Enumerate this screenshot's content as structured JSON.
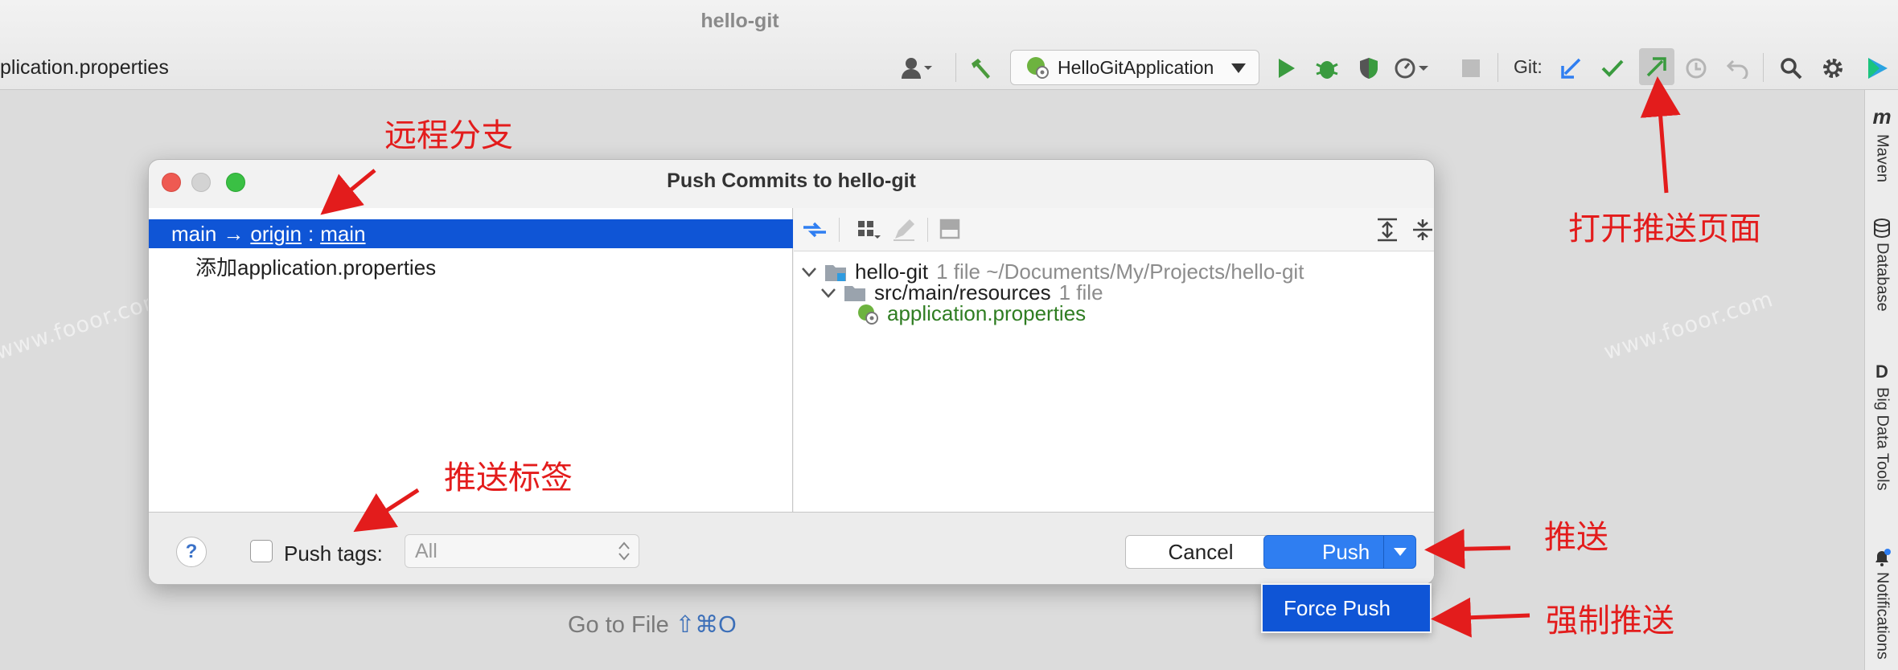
{
  "window": {
    "title": "hello-git",
    "file_tab": "plication.properties"
  },
  "toolbar": {
    "run_config": "HelloGitApplication",
    "git_label": "Git:",
    "accent": "#2f7ef1"
  },
  "right_sidebar": {
    "items": [
      {
        "label": "Maven",
        "icon": "maven-icon"
      },
      {
        "label": "Database",
        "icon": "database-icon"
      },
      {
        "label": "Big Data Tools",
        "icon": "big-data-tools-icon"
      },
      {
        "label": "Notifications",
        "icon": "bell-icon"
      }
    ]
  },
  "background": {
    "goto_file": "Go to File",
    "goto_shortcut": "⇧⌘O"
  },
  "watermark": "www.fooor.com",
  "dialog": {
    "title": "Push Commits to hello-git",
    "branch": {
      "local": "main",
      "arrow": "→",
      "remote": "origin",
      "sep": ":",
      "remote_branch": "main"
    },
    "commit": "添加application.properties",
    "tree": {
      "repo": {
        "name": "hello-git",
        "info": "1 file ~/Documents/My/Projects/hello-git"
      },
      "folder": {
        "name": "src/main/resources",
        "info": "1 file"
      },
      "file": {
        "name": "application.properties"
      }
    },
    "footer": {
      "help": "?",
      "push_tags_label": "Push tags:",
      "push_tags_checked": false,
      "tags_select_value": "All",
      "cancel": "Cancel",
      "push": "Push"
    },
    "dropdown": {
      "force_push": "Force Push"
    },
    "selection_color": "#0f55d6"
  },
  "annotations": {
    "remote_branch": "远程分支",
    "open_push": "打开推送页面",
    "push_tags": "推送标签",
    "push": "推送",
    "force_push": "强制推送",
    "color": "#e31c1c"
  }
}
